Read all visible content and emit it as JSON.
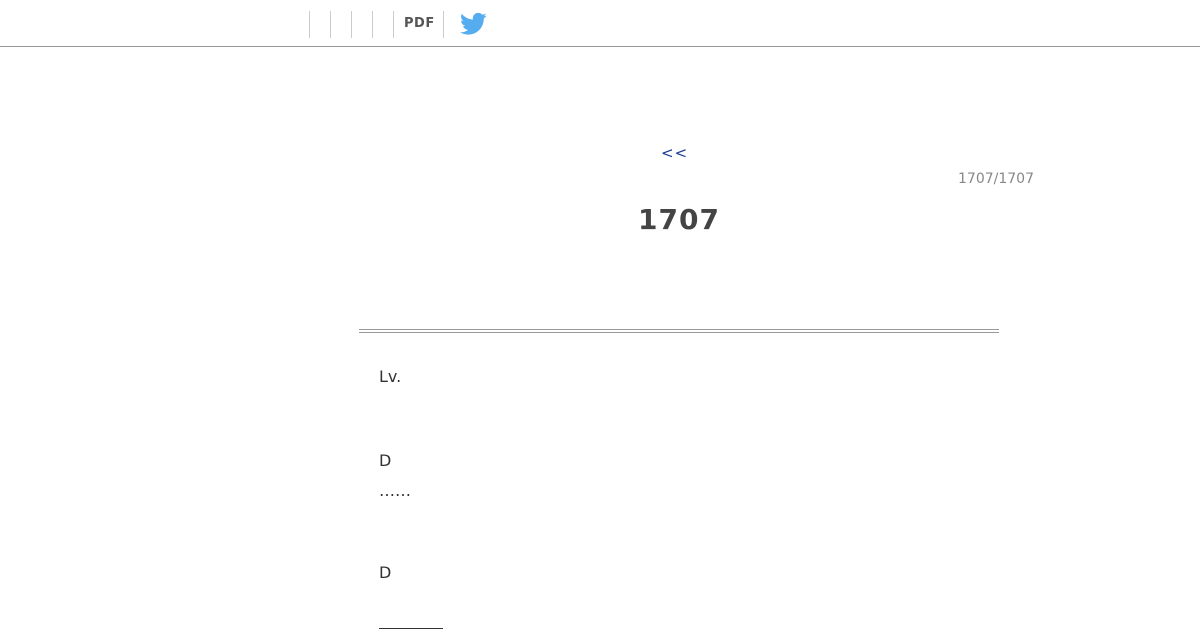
{
  "toolbar": {
    "pdf_label": "PDF",
    "share_icon": "twitter-icon",
    "twitter_color": "#55acee"
  },
  "nav": {
    "prev_label": "<<",
    "page_count": "1707/1707"
  },
  "article": {
    "title": "1707",
    "lines": [
      "Lv.",
      "D",
      "……",
      "D"
    ]
  }
}
